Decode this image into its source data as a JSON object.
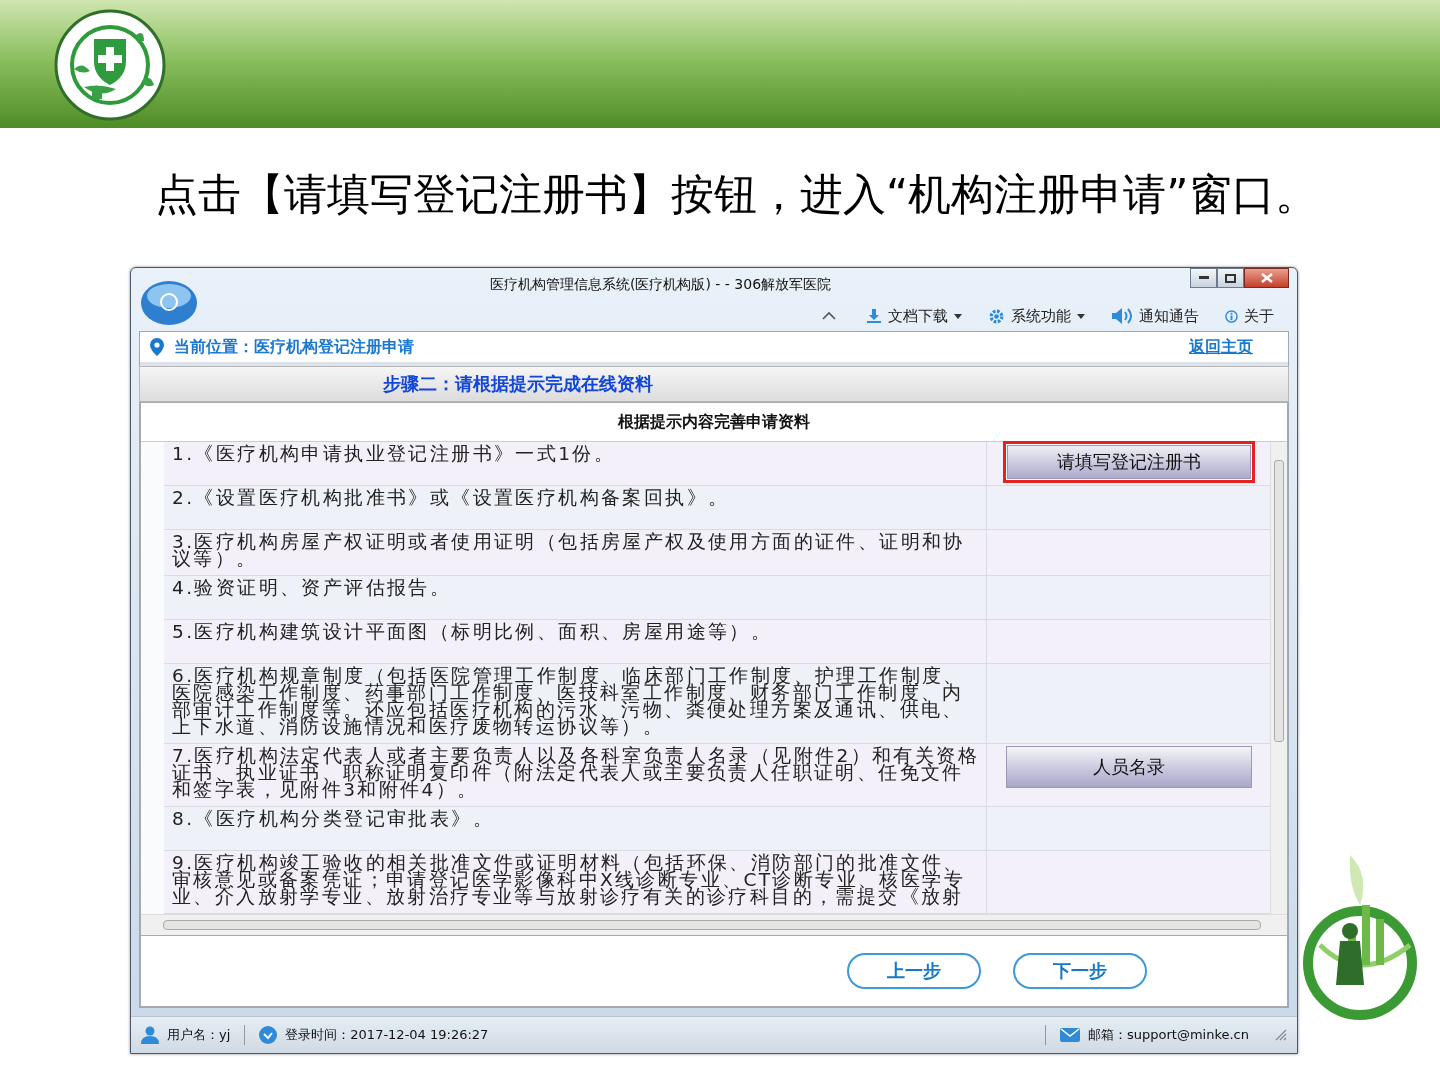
{
  "slide": {
    "heading": "点击【请填写登记注册书】按钮，进入“机构注册申请”窗口。"
  },
  "window": {
    "title": "医疗机构管理信息系统(医疗机构版) - - 306解放军医院",
    "menu": [
      {
        "kind": "download",
        "label": "文档下载",
        "dropdown": true
      },
      {
        "kind": "gear",
        "label": "系统功能",
        "dropdown": true
      },
      {
        "kind": "speaker",
        "label": "通知通告",
        "dropdown": false
      },
      {
        "kind": "info",
        "label": "关于",
        "dropdown": false
      }
    ]
  },
  "breadcrumb": {
    "text": "当前位置：医疗机构登记注册申请",
    "home_link": "返回主页"
  },
  "step_title": "步骤二：请根据提示完成在线资料",
  "table_header": "根据提示内容完善申请资料",
  "rows": [
    {
      "text": "1.《医疗机构申请执业登记注册书》一式1份。",
      "action": "请填写登记注册书",
      "highlighted": true
    },
    {
      "text": "2.《设置医疗机构批准书》或《设置医疗机构备案回执》。"
    },
    {
      "text": "3.医疗机构房屋产权证明或者使用证明（包括房屋产权及使用方面的证件、证明和协议等）。"
    },
    {
      "text": "4.验资证明、资产评估报告。"
    },
    {
      "text": "5.医疗机构建筑设计平面图（标明比例、面积、房屋用途等）。"
    },
    {
      "text": "6.医疗机构规章制度（包括医院管理工作制度、临床部门工作制度、护理工作制度、医院感染工作制度、药事部门工作制度、医技科室工作制度、财务部门工作制度、内部审计工作制度等。还应包括医疗机构的污水、污物、粪便处理方案及通讯、供电、上下水道、消防设施情况和医疗废物转运协议等）。"
    },
    {
      "text": "7.医疗机构法定代表人或者主要负责人以及各科室负责人名录（见附件2）和有关资格证书、执业证书、职称证明复印件（附法定代表人或主要负责人任职证明、任免文件和签字表，见附件3和附件4）。",
      "action": "人员名录",
      "highlighted": false
    },
    {
      "text": "8.《医疗机构分类登记审批表》。"
    },
    {
      "text": "9.医疗机构竣工验收的相关批准文件或证明材料（包括环保、消防部门的批准文件、审核意见或备案凭证；申请登记医学影像科中X线诊断专业、CT诊断专业、核医学专业、介入放射学专业、放射治疗专业等与放射诊疗有关的诊疗科目的，需提交《放射"
    }
  ],
  "buttons": [
    "上一步",
    "下一步"
  ],
  "status_bar": {
    "user": "用户名：yj",
    "login_time": "登录时间：2017-12-04 19:26:27",
    "email": "邮箱：support@minke.cn"
  }
}
